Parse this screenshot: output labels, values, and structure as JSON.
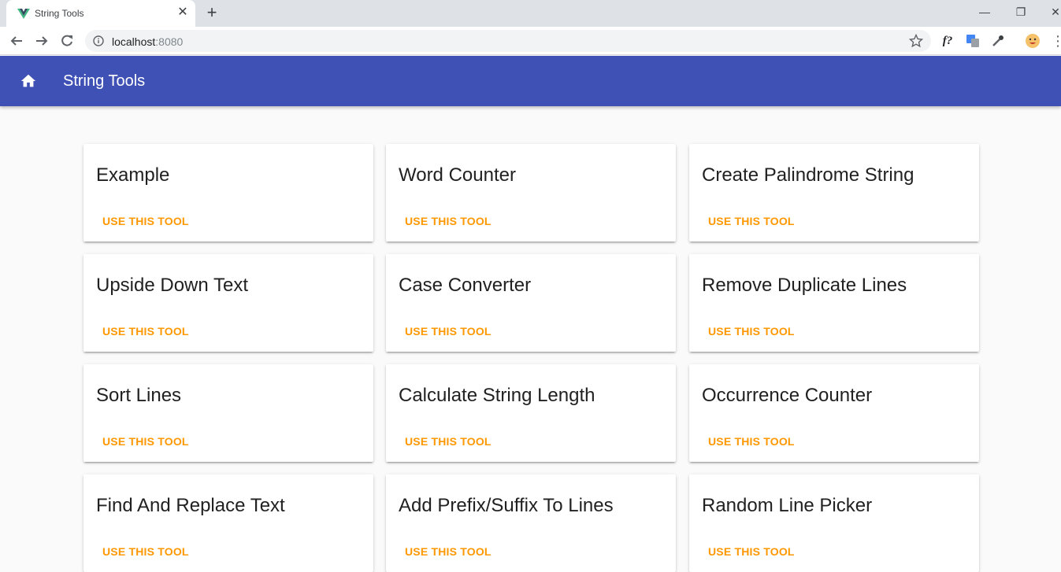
{
  "browser": {
    "tab_title": "String Tools",
    "new_tab_icon": "plus-icon",
    "url_host": "localhost",
    "url_port": ":8080"
  },
  "appbar": {
    "title": "String Tools",
    "color": "#3f51b5",
    "home_icon": "home-icon"
  },
  "accent_color": "#ff9800",
  "cards": [
    {
      "title": "Example",
      "button": "USE THIS TOOL"
    },
    {
      "title": "Word Counter",
      "button": "USE THIS TOOL"
    },
    {
      "title": "Create Palindrome String",
      "button": "USE THIS TOOL"
    },
    {
      "title": "Upside Down Text",
      "button": "USE THIS TOOL"
    },
    {
      "title": "Case Converter",
      "button": "USE THIS TOOL"
    },
    {
      "title": "Remove Duplicate Lines",
      "button": "USE THIS TOOL"
    },
    {
      "title": "Sort Lines",
      "button": "USE THIS TOOL"
    },
    {
      "title": "Calculate String Length",
      "button": "USE THIS TOOL"
    },
    {
      "title": "Occurrence Counter",
      "button": "USE THIS TOOL"
    },
    {
      "title": "Find And Replace Text",
      "button": "USE THIS TOOL"
    },
    {
      "title": "Add Prefix/Suffix To Lines",
      "button": "USE THIS TOOL"
    },
    {
      "title": "Random Line Picker",
      "button": "USE THIS TOOL"
    }
  ]
}
